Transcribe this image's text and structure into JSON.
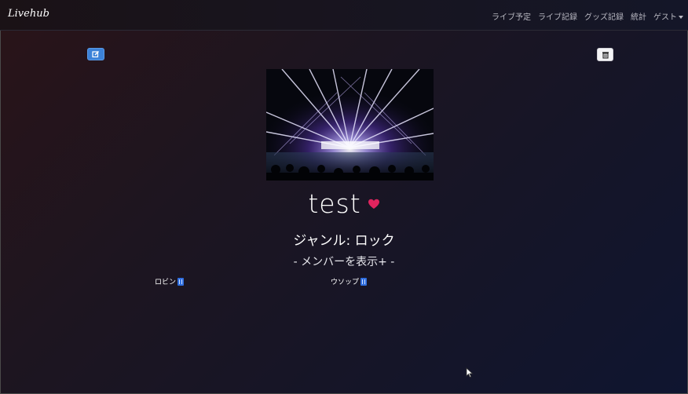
{
  "navbar": {
    "brand": "Livehub",
    "links": {
      "upcoming": "ライブ予定",
      "records": "ライブ記録",
      "goods": "グッズ記録",
      "stats": "統計",
      "user": "ゲスト"
    }
  },
  "artist": {
    "name": "test",
    "favorite": true,
    "genre_text": "ジャンル: ロック",
    "toggle_members": "- メンバーを表示+ -",
    "members": [
      {
        "name": "ロビン"
      },
      {
        "name": "ウソップ"
      }
    ]
  },
  "icons": {
    "edit": "edit-icon",
    "delete": "trash-icon",
    "favorite": "heart-icon",
    "caret": "caret-down-icon"
  },
  "colors": {
    "heart": "#e0245e",
    "edit_button": "#3c82d8",
    "member_delete": "#2f6ee0"
  }
}
